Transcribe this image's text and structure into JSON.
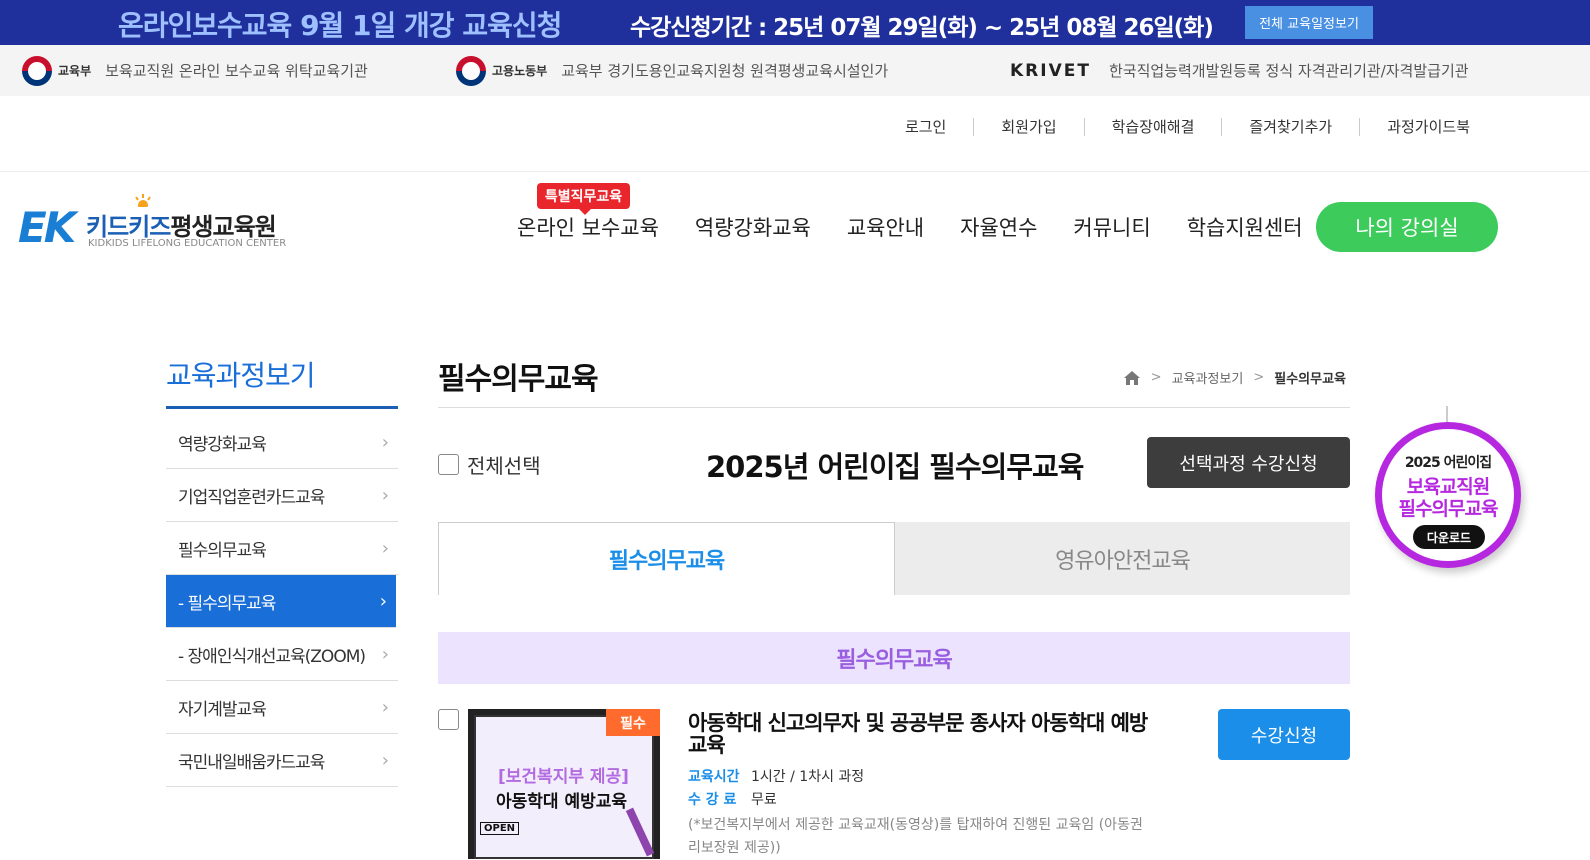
{
  "top_banner": {
    "headline": "온라인보수교육 9월 1일 개강 교육신청",
    "period": "수강신청기간 : 25년 07월 29일(화) ~ 25년 08월 26일(화)",
    "schedule_button": "전체 교육일정보기"
  },
  "cert_bar": [
    {
      "org": "교육부",
      "text": "보육교직원 온라인 보수교육 위탁교육기관"
    },
    {
      "org": "고용노동부",
      "text": "교육부 경기도용인교육지원청 원격평생교육시설인가"
    },
    {
      "org": "KRIVET",
      "text": "한국직업능력개발원등록 정식 자격관리기관/자격발급기관"
    }
  ],
  "util_links": [
    "로그인",
    "회원가입",
    "학습장애해결",
    "즐겨찾기추가",
    "과정가이드북"
  ],
  "logo": {
    "mark": "EK",
    "name_a": "키드키즈",
    "name_b": "평생교육원",
    "sub": "KIDKIDS LIFELONG EDUCATION CENTER"
  },
  "gnb": {
    "badge": "특별직무교육",
    "items": [
      "온라인 보수교육",
      "역량강화교육",
      "교육안내",
      "자율연수",
      "커뮤니티",
      "학습지원센터"
    ],
    "my_room": "나의 강의실"
  },
  "lnb": {
    "title": "교육과정보기",
    "items": [
      {
        "label": "역량강화교육",
        "active": false
      },
      {
        "label": "기업직업훈련카드교육",
        "active": false
      },
      {
        "label": "필수의무교육",
        "active": false
      },
      {
        "label": "- 필수의무교육",
        "active": true
      },
      {
        "label": "- 장애인식개선교육(ZOOM)",
        "active": false
      },
      {
        "label": "자기계발교육",
        "active": false
      },
      {
        "label": "국민내일배움카드교육",
        "active": false
      }
    ]
  },
  "content": {
    "title": "필수의무교육",
    "breadcrumb": [
      "교육과정보기",
      "필수의무교육"
    ],
    "select_all": "전체선택",
    "year_title": "2025년 어린이집 필수의무교육",
    "apply_selected": "선택과정 수강신청",
    "tabs": [
      "필수의무교육",
      "영유아안전교육"
    ],
    "section": "필수의무교육",
    "course": {
      "tag": "필수",
      "thumb_line1": "[보건복지부 제공]",
      "thumb_line2": "아동학대 예방교육",
      "thumb_open": "OPEN",
      "title": "아동학대 신고의무자 및 공공부문 종사자 아동학대 예방교육",
      "time_label": "교육시간",
      "time_value": "1시간 / 1차시 과정",
      "fee_label": "수 강 료",
      "fee_value": "무료",
      "note": "(*보건복지부에서 제공한 교육교재(동영상)를 탑재하여 진행된 교육임 (아동권리보장원 제공))",
      "apply": "수강신청"
    }
  },
  "float_badge": {
    "line1": "2025 어린이집",
    "line2": "보육교직원",
    "line3": "필수의무교육",
    "download": "다운로드"
  },
  "colors": {
    "banner": "#1f2f9c",
    "accent": "#1a6ed8",
    "green": "#3dcb5c",
    "purple": "#b628e0"
  }
}
